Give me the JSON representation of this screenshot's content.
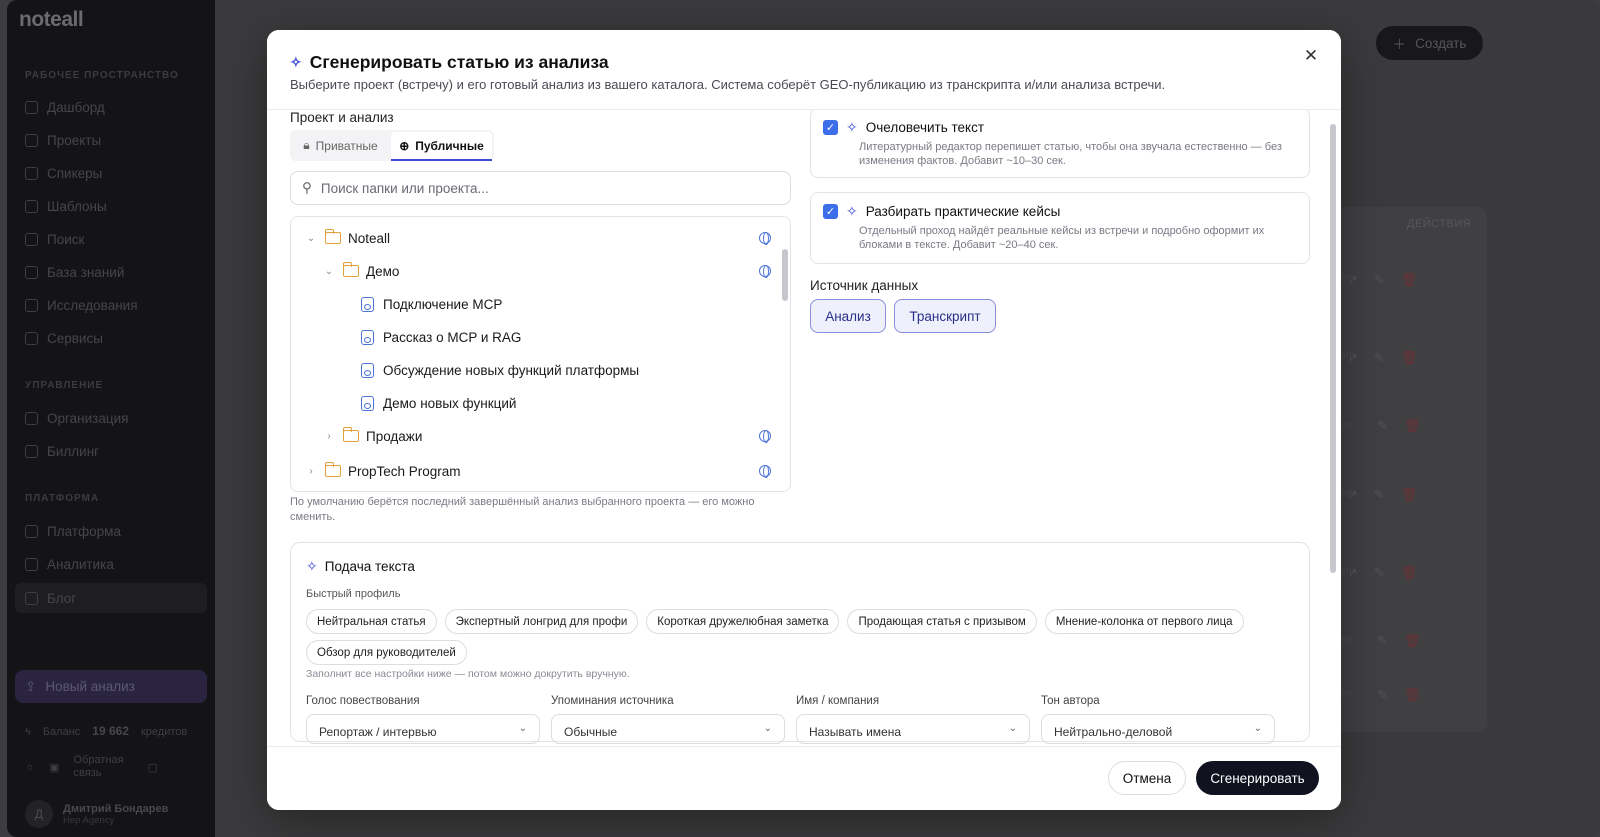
{
  "app": {
    "logo": "noteall",
    "sidebar": {
      "sections": [
        {
          "title": "РАБОЧЕЕ ПРОСТРАНСТВО",
          "items": [
            "Дашборд",
            "Проекты",
            "Спикеры",
            "Шаблоны",
            "Поиск",
            "База знаний",
            "Исследования",
            "Сервисы"
          ]
        },
        {
          "title": "УПРАВЛЕНИЕ",
          "items": [
            "Организация",
            "Биллинг"
          ]
        },
        {
          "title": "ПЛАТФОРМА",
          "items": [
            "Платформа",
            "Аналитика",
            "Блог"
          ]
        }
      ],
      "new_analysis": "Новый анализ",
      "balance_label": "Баланс",
      "balance_value": "19 662",
      "balance_unit": "кредитов",
      "feedback": "Обратная связь",
      "user_initial": "Д",
      "user_name": "Дмитрий Бондарев",
      "user_org": "Hep Agency"
    },
    "create_button": "Создать",
    "actions_header": "ДЕЙСТВИЯ"
  },
  "modal": {
    "title": "Сгенерировать статью из анализа",
    "subtitle": "Выберите проект (встречу) и его готовый анализ из вашего каталога. Система соберёт GEO-публикацию из транскрипта и/или анализа встречи.",
    "project_label": "Проект и анализ",
    "tabs": {
      "private": "Приватные",
      "public": "Публичные"
    },
    "search_placeholder": "Поиск папки или проекта...",
    "tree": {
      "root": "Noteall",
      "demo": "Демо",
      "demo_items": [
        "Подключение MCP",
        "Рассказ о MCP и RAG",
        "Обсуждение новых функций платформы",
        "Демо новых функций"
      ],
      "sales": "Продажи",
      "proptech": "PropTech Program"
    },
    "tree_hint": "По умолчанию берётся последний завершённый анализ выбранного проекта — его можно сменить.",
    "options": [
      {
        "title": "Очеловечить текст",
        "desc": "Литературный редактор перепишет статью, чтобы она звучала естественно — без изменения фактов. Добавит ~10–30 сек.",
        "checked": true
      },
      {
        "title": "Разбирать практические кейсы",
        "desc": "Отдельный проход найдёт реальные кейсы из встречи и подробно оформит их блоками в тексте. Добавит ~20–40 сек.",
        "checked": true
      }
    ],
    "source_label": "Источник данных",
    "source_buttons": {
      "analysis": "Анализ",
      "transcript": "Транскрипт"
    },
    "style": {
      "title": "Подача текста",
      "profile_label": "Быстрый профиль",
      "chips": [
        "Нейтральная статья",
        "Экспертный лонгрид для профи",
        "Короткая дружелюбная заметка",
        "Продающая статья с призывом",
        "Мнение-колонка от первого лица",
        "Обзор для руководителей"
      ],
      "hint": "Заполнит все настройки ниже — потом можно докрутить вручную.",
      "fields": [
        {
          "label": "Голос повествования",
          "value": "Репортаж / интервью"
        },
        {
          "label": "Упоминания источника",
          "value": "Обычные"
        },
        {
          "label": "Имя / компания",
          "value": "Называть имена"
        },
        {
          "label": "Тон автора",
          "value": "Нейтрально-деловой"
        }
      ]
    },
    "cancel": "Отмена",
    "generate": "Сгенерировать"
  }
}
